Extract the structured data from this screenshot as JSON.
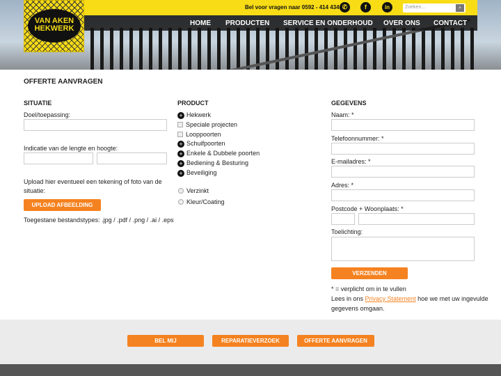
{
  "header": {
    "logo_text": "VAN AKEN HEKWERK",
    "phone_text": "Bel voor vragen naar 0592 - 414 434",
    "search_placeholder": "Zoeken...",
    "nav": [
      "HOME",
      "PRODUCTEN",
      "SERVICE EN ONDERHOUD",
      "OVER ONS",
      "CONTACT"
    ]
  },
  "page_title": "OFFERTE AANVRAGEN",
  "situatie": {
    "title": "SITUATIE",
    "doel_label": "Doel/toepassing:",
    "indicatie_label": "Indicatie van de lengte en hoogte:",
    "upload_text": "Upload hier eventueel een tekening of foto van de situatie:",
    "upload_button": "UPLOAD AFBEELDING",
    "filetypes": "Toegestane bestandstypes: .jpg / .pdf / .png / .ai / .eps"
  },
  "product": {
    "title": "PRODUCT",
    "items": [
      {
        "label": "Hekwerk",
        "type": "expand"
      },
      {
        "label": "Speciale projecten",
        "type": "checkbox"
      },
      {
        "label": "Looppoorten",
        "type": "checkbox"
      },
      {
        "label": "Schuifpoorten",
        "type": "expand"
      },
      {
        "label": "Enkele & Dubbele poorten",
        "type": "expand"
      },
      {
        "label": "Bediening & Besturing",
        "type": "expand"
      },
      {
        "label": "Beveiliging",
        "type": "expand"
      }
    ],
    "finish": [
      "Verzinkt",
      "Kleur/Coating"
    ]
  },
  "gegevens": {
    "title": "GEGEVENS",
    "fields": [
      "Naam: *",
      "Telefoonnummer: *",
      "E-mailadres: *",
      "Adres: *",
      "Postcode + Woonplaats: *",
      "Toelichting:"
    ],
    "submit": "VERZENDEN",
    "required_note": "* = verplicht om in te vullen",
    "privacy_pre": "Lees in ons ",
    "privacy_link": "Privacy Statement",
    "privacy_post": " hoe we met uw ingevulde",
    "privacy_line2": "gegevens omgaan."
  },
  "footer": {
    "buttons": [
      "BEL MIJ",
      "REPARATIEVERZOEK",
      "OFFERTE AANVRAGEN"
    ]
  },
  "colors": {
    "accent": "#f58220",
    "brand_yellow": "#f7dc16"
  }
}
